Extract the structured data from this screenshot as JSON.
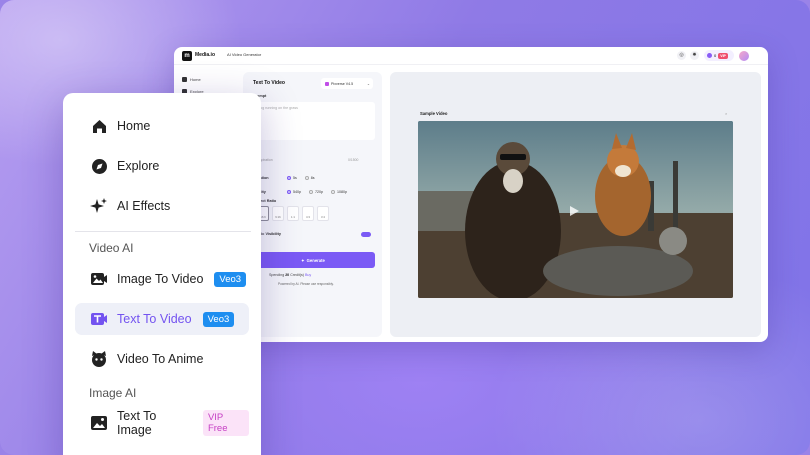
{
  "colors": {
    "accent": "#7b5af5",
    "veo_badge": "#1e8ef0",
    "vip_badge_bg": "#fbe3f8",
    "vip_badge_text": "#c640c4",
    "active_nav_bg": "#eef0f8"
  },
  "app": {
    "brand": "Media.io",
    "page_title": "AI Video Generator",
    "topbar": {
      "icons": [
        "discord-icon",
        "settings-icon"
      ],
      "credits_value": "0",
      "vip_label": "VIP"
    },
    "mini_nav": [
      "Home",
      "Explore"
    ],
    "form": {
      "title": "Text To Video",
      "model": "Pixverse V4.5",
      "prompt_label": "Prompt",
      "prompt_placeholder": "A dog running on the grass",
      "prompt_footer": "Inspiration",
      "prompt_count": "0/1500",
      "duration_label": "Duration",
      "duration_options": [
        "5s",
        "8s"
      ],
      "quality_label": "Quality",
      "quality_options": [
        "540p",
        "720p",
        "1080p"
      ],
      "aspect_label": "Aspect Ratio",
      "aspect_options": [
        "16:9",
        "9:16",
        "1:1",
        "4:3",
        "3:4"
      ],
      "visibility_label": "Public Visibility",
      "generate_label": "Generate",
      "spend_prefix": "Spending",
      "spend_value": "20",
      "spend_suffix": "Credit(s)",
      "buy_label": "Buy",
      "powered_text": "Powered by AI. Please use responsibly."
    },
    "preview": {
      "label": "Sample Video"
    }
  },
  "sidebar": {
    "items": [
      {
        "label": "Home",
        "icon": "home-icon"
      },
      {
        "label": "Explore",
        "icon": "explore-icon"
      },
      {
        "label": "AI Effects",
        "icon": "sparkle-icon"
      }
    ],
    "video_section": "Video AI",
    "video_items": [
      {
        "label": "Image To Video",
        "badge": "Veo3",
        "icon": "image-video-icon"
      },
      {
        "label": "Text To Video",
        "badge": "Veo3",
        "icon": "text-video-icon",
        "active": true
      },
      {
        "label": "Video To Anime",
        "icon": "anime-icon"
      }
    ],
    "image_section": "Image AI",
    "image_items": [
      {
        "label": "Text To Image",
        "badge": "VIP Free",
        "icon": "text-image-icon"
      }
    ]
  }
}
